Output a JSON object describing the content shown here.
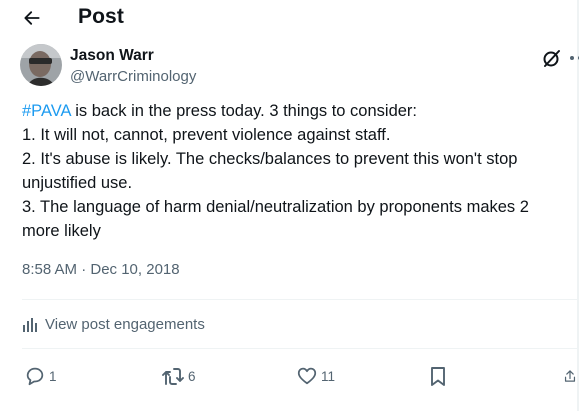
{
  "header": {
    "title": "Post",
    "back_icon": "arrow-left-icon"
  },
  "author": {
    "name": "Jason Warr",
    "handle": "@WarrCriminology",
    "avatar_icon": "profile-photo"
  },
  "tweet": {
    "hashtag": "#PAVA",
    "line1_rest": " is back in the press today. 3 things to consider:",
    "line2": "1. It will not, cannot, prevent violence against staff.",
    "line3": "2. It's abuse is likely. The checks/balances to prevent this won't stop",
    "line4": "unjustified use.",
    "line5": "3. The language of harm denial/neutralization by proponents makes 2",
    "line6": "more likely",
    "timestamp": "8:58 AM · Dec 10, 2018"
  },
  "engagements": {
    "label": "View post engagements",
    "icon": "bar-chart-icon"
  },
  "actions": {
    "reply_count": "1",
    "repost_count": "6",
    "like_count": "11"
  },
  "colors": {
    "accent": "#1d9bf0",
    "text": "#0f1419",
    "secondary": "#536471",
    "divider": "#eff3f4"
  }
}
